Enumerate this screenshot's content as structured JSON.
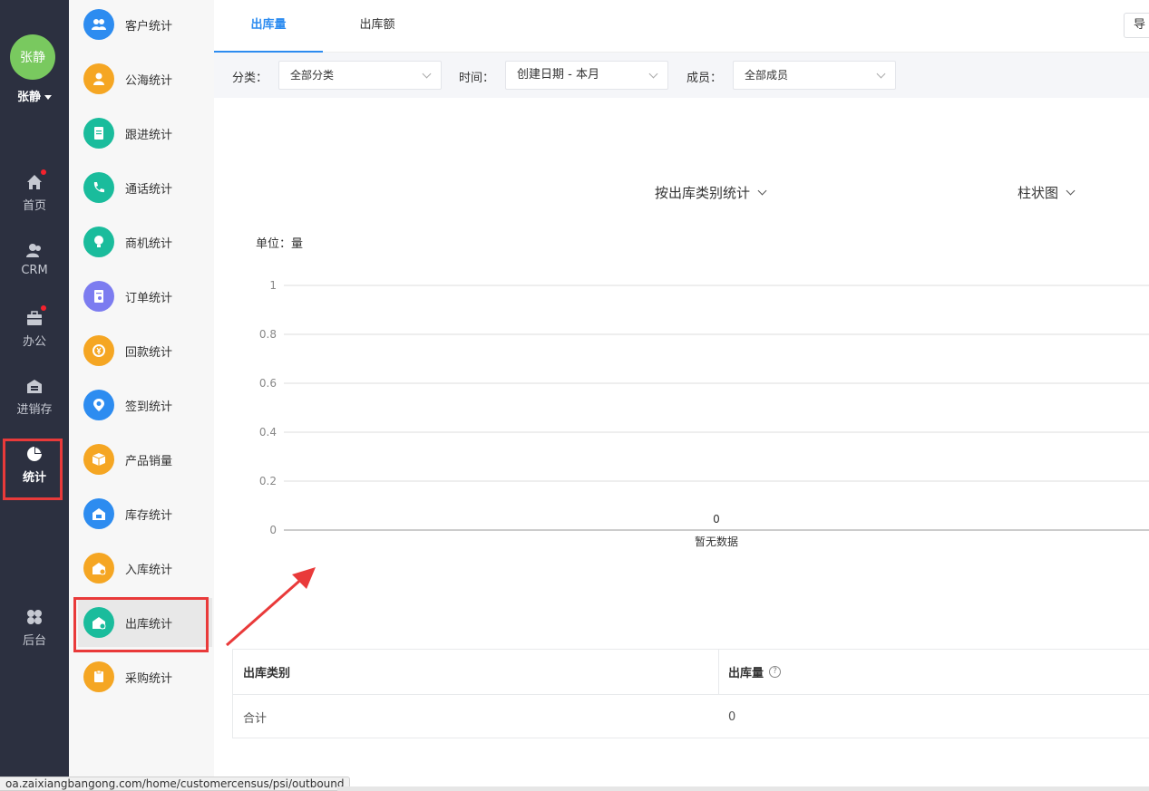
{
  "user": {
    "avatar_text": "张静",
    "name": "张静"
  },
  "rail": [
    {
      "label": "首页",
      "icon": "home-icon",
      "badge": true
    },
    {
      "label": "CRM",
      "icon": "users-icon",
      "badge": false
    },
    {
      "label": "办公",
      "icon": "briefcase-icon",
      "badge": true
    },
    {
      "label": "进销存",
      "icon": "warehouse-icon",
      "badge": false
    },
    {
      "label": "统计",
      "icon": "pie-chart-icon",
      "badge": false,
      "active": true
    },
    {
      "label": "后台",
      "icon": "grid-icon",
      "badge": false
    }
  ],
  "subnav": [
    {
      "label": "客户统计",
      "color": "#2d8cf0",
      "icon": "customers-icon"
    },
    {
      "label": "公海统计",
      "color": "#f5a623",
      "icon": "person-icon"
    },
    {
      "label": "跟进统计",
      "color": "#1abc9c",
      "icon": "note-icon"
    },
    {
      "label": "通话统计",
      "color": "#1abc9c",
      "icon": "phone-icon"
    },
    {
      "label": "商机统计",
      "color": "#1abc9c",
      "icon": "lightbulb-icon"
    },
    {
      "label": "订单统计",
      "color": "#7c7cf0",
      "icon": "order-icon"
    },
    {
      "label": "回款统计",
      "color": "#f5a623",
      "icon": "payment-icon"
    },
    {
      "label": "签到统计",
      "color": "#2d8cf0",
      "icon": "location-icon"
    },
    {
      "label": "产品销量",
      "color": "#f5a623",
      "icon": "box-icon"
    },
    {
      "label": "库存统计",
      "color": "#2d8cf0",
      "icon": "stock-icon"
    },
    {
      "label": "入库统计",
      "color": "#f5a623",
      "icon": "inbound-icon"
    },
    {
      "label": "出库统计",
      "color": "#1abc9c",
      "icon": "outbound-icon",
      "active": true
    },
    {
      "label": "采购统计",
      "color": "#f5a623",
      "icon": "purchase-icon"
    }
  ],
  "tabs": [
    {
      "label": "出库量",
      "active": true
    },
    {
      "label": "出库额",
      "active": false
    }
  ],
  "export_label": "导",
  "filters": {
    "category_label": "分类：",
    "category_value": "全部分类",
    "time_label": "时间：",
    "time_value": "创建日期 - 本月",
    "member_label": "成员：",
    "member_value": "全部成员"
  },
  "chart_group_by": "按出库类别统计",
  "chart_type_select": "柱状图",
  "chart_data": {
    "type": "bar",
    "unit_label": "单位：量",
    "categories": [
      "暂无数据"
    ],
    "values": [
      0
    ],
    "y_ticks": [
      "1",
      "0.8",
      "0.6",
      "0.4",
      "0.2",
      "0"
    ],
    "ylim": [
      0,
      1
    ],
    "grid": true
  },
  "table": {
    "headers": [
      "出库类别",
      "出库量"
    ],
    "rows": [
      [
        "合计",
        "0"
      ]
    ]
  },
  "status_url": "oa.zaixiangbangong.com/home/customercensus/psi/outbound"
}
